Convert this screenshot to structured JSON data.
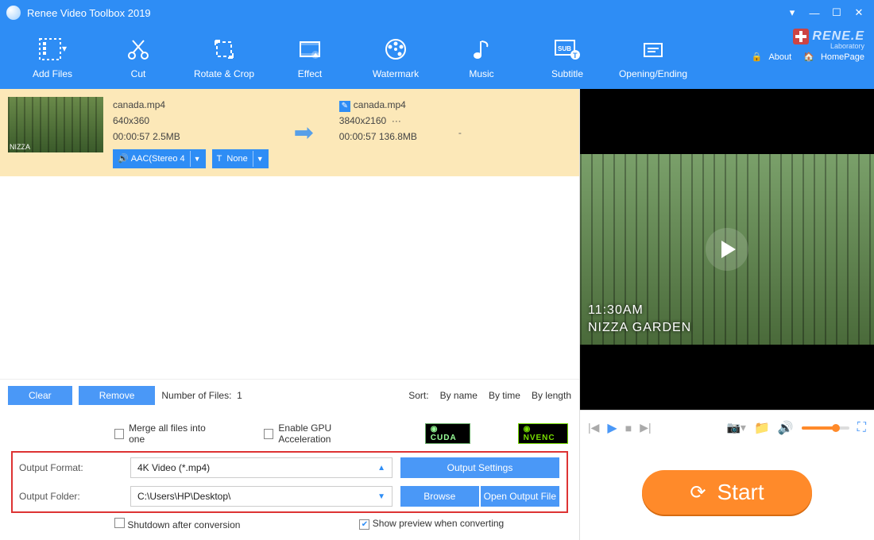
{
  "title": "Renee Video Toolbox 2019",
  "brand": {
    "name": "RENE.E",
    "sub": "Laboratory",
    "about": "About",
    "homepage": "HomePage"
  },
  "toolbar": [
    {
      "label": "Add Files"
    },
    {
      "label": "Cut"
    },
    {
      "label": "Rotate & Crop"
    },
    {
      "label": "Effect"
    },
    {
      "label": "Watermark"
    },
    {
      "label": "Music"
    },
    {
      "label": "Subtitle"
    },
    {
      "label": "Opening/Ending"
    }
  ],
  "file": {
    "src": {
      "name": "canada.mp4",
      "res": "640x360",
      "dur": "00:00:57",
      "size": "2.5MB"
    },
    "out": {
      "name": "canada.mp4",
      "res": "3840x2160",
      "more": "···",
      "dur": "00:00:57",
      "size": "136.8MB"
    },
    "audio_chip": "AAC(Stereo 4",
    "subtitle_chip": "None",
    "dash": "-"
  },
  "listfooter": {
    "clear": "Clear",
    "remove": "Remove",
    "count_label": "Number of Files:",
    "count": "1",
    "sort_label": "Sort:",
    "by_name": "By name",
    "by_time": "By time",
    "by_length": "By length"
  },
  "checks": {
    "merge": "Merge all files into one",
    "gpu": "Enable GPU Acceleration",
    "cuda": "CUDA",
    "nvenc": "NVENC",
    "shutdown": "Shutdown after conversion",
    "preview": "Show preview when converting"
  },
  "output": {
    "format_label": "Output Format:",
    "format_value": "4K Video (*.mp4)",
    "folder_label": "Output Folder:",
    "folder_value": "C:\\Users\\HP\\Desktop\\",
    "settings": "Output Settings",
    "browse": "Browse",
    "open": "Open Output File"
  },
  "preview": {
    "time": "11:30AM",
    "place": "NIZZA GARDEN"
  },
  "start": "Start"
}
